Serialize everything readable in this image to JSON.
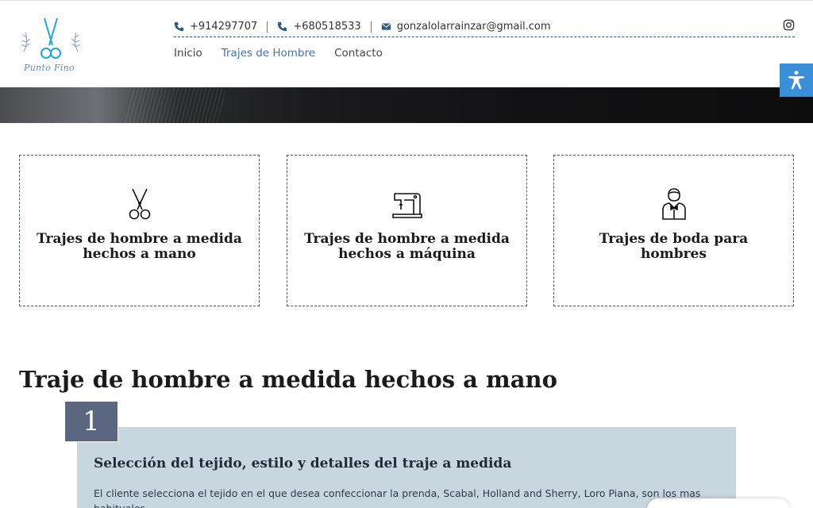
{
  "brand": {
    "logo_text": "Punto Fino"
  },
  "contact": {
    "phone1": "+914297707",
    "phone2": "+680518533",
    "email": "gonzalolarrainzar@gmail.com"
  },
  "nav": [
    {
      "label": "Inicio",
      "active": false
    },
    {
      "label": "Trajes de Hombre",
      "active": true
    },
    {
      "label": "Contacto",
      "active": false
    }
  ],
  "cards": [
    {
      "title": "Trajes de hombre a medida hechos a mano",
      "icon": "scissors-icon"
    },
    {
      "title": "Trajes de hombre a medida hechos a máquina",
      "icon": "sewing-machine-icon"
    },
    {
      "title": "Trajes de boda para hombres",
      "icon": "groom-icon"
    }
  ],
  "section": {
    "title": "Traje de hombre a medida hechos a mano",
    "step": {
      "number": "1",
      "title": "Selección del tejido, estilo y detalles del traje a medida",
      "text": "El cliente selecciona el tejido en el que desea confeccionar la prenda, Scabal, Holland and Sherry, Loro Piana, son los mas habituales."
    }
  },
  "colors": {
    "accent": "#4a72a8",
    "accessibility_button": "#3a8fd8",
    "step_badge": "#5b6780",
    "step_panel": "#c8d6df"
  }
}
